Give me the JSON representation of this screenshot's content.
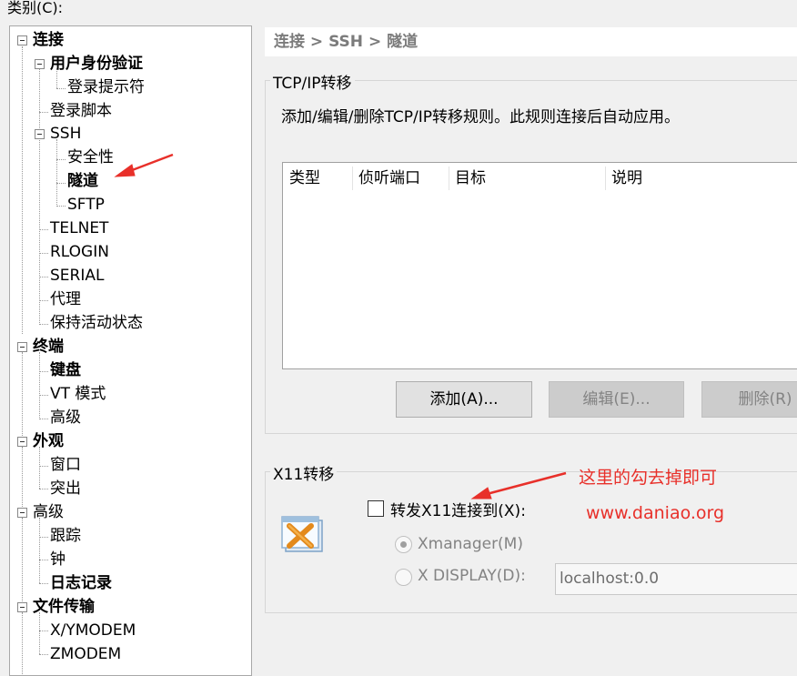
{
  "category_label": "类别(C):",
  "tree": {
    "connection": "连接",
    "user_auth": "用户身份验证",
    "login_prompt": "登录提示符",
    "login_script": "登录脚本",
    "ssh": "SSH",
    "security": "安全性",
    "tunnel": "隧道",
    "sftp": "SFTP",
    "telnet": "TELNET",
    "rlogin": "RLOGIN",
    "serial": "SERIAL",
    "proxy": "代理",
    "keepalive": "保持活动状态",
    "terminal": "终端",
    "keyboard": "键盘",
    "vt_mode": "VT 模式",
    "term_advanced": "高级",
    "appearance": "外观",
    "window": "窗口",
    "highlight": "突出",
    "advanced": "高级",
    "trace": "跟踪",
    "bell": "钟",
    "logging": "日志记录",
    "file_transfer": "文件传输",
    "xymodem": "X/YMODEM",
    "zmodem": "ZMODEM"
  },
  "breadcrumb": "连接 > SSH > 隧道",
  "tcp": {
    "title": "TCP/IP转移",
    "description": "添加/编辑/删除TCP/IP转移规则。此规则连接后自动应用。",
    "columns": [
      "类型",
      "侦听端口",
      "目标",
      "说明"
    ],
    "add_button": "添加(A)...",
    "edit_button": "编辑(E)...",
    "delete_button": "删除(R)"
  },
  "x11": {
    "title": "X11转移",
    "forward_label": "转发X11连接到(X):",
    "forward_checked": false,
    "xmanager_label": "Xmanager(M)",
    "xdisplay_label": "X DISPLAY(D):",
    "display_value": "localhost:0.0"
  },
  "annotations": {
    "note": "这里的勾去掉即可",
    "url": "www.daniao.org",
    "color": "#e8302a"
  }
}
